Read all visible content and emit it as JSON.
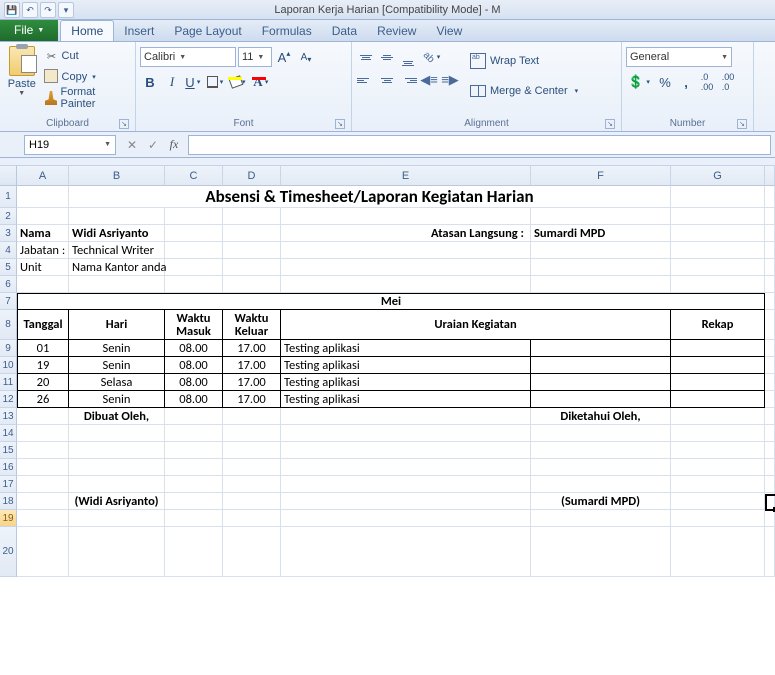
{
  "app": {
    "title": "Laporan Kerja Harian  [Compatibility Mode]  -  M",
    "qat": {
      "save": "💾",
      "undo": "↶",
      "redo": "↷"
    }
  },
  "tabs": {
    "file": "File",
    "home": "Home",
    "insert": "Insert",
    "pageLayout": "Page Layout",
    "formulas": "Formulas",
    "data": "Data",
    "review": "Review",
    "view": "View"
  },
  "ribbon": {
    "clipboard": {
      "paste": "Paste",
      "cut": "Cut",
      "copy": "Copy",
      "formatPainter": "Format Painter",
      "label": "Clipboard"
    },
    "font": {
      "name": "Calibri",
      "size": "11",
      "label": "Font"
    },
    "alignment": {
      "wrapText": "Wrap Text",
      "mergeCenter": "Merge & Center",
      "label": "Alignment"
    },
    "number": {
      "format": "General",
      "label": "Number"
    }
  },
  "namebox": "H19",
  "columns": [
    "A",
    "B",
    "C",
    "D",
    "E",
    "F",
    "G"
  ],
  "rows": [
    1,
    2,
    3,
    4,
    5,
    6,
    7,
    8,
    9,
    10,
    11,
    12,
    13,
    14,
    15,
    16,
    17,
    18,
    19,
    20
  ],
  "sheet": {
    "title": "Absensi & Timesheet/Laporan Kegiatan Harian",
    "labels": {
      "nama": "Nama",
      "jabatan": "Jabatan :",
      "unit": "Unit",
      "atasan": "Atasan Langsung :",
      "dibuat": "Dibuat Oleh,",
      "diketahui": "Diketahui Oleh,"
    },
    "info": {
      "nama": "Widi Asriyanto",
      "jabatan": "Technical Writer",
      "unit": "Nama Kantor anda",
      "atasan": "Sumardi MPD"
    },
    "month": "Mei",
    "headers": {
      "tanggal": "Tanggal",
      "hari": "Hari",
      "masuk": "Waktu Masuk",
      "keluar": "Waktu Keluar",
      "uraian": "Uraian Kegiatan",
      "rekap": "Rekap"
    },
    "rowsData": [
      {
        "tgl": "01",
        "hari": "Senin",
        "in": "08.00",
        "out": "17.00",
        "act": "Testing aplikasi"
      },
      {
        "tgl": "19",
        "hari": "Senin",
        "in": "08.00",
        "out": "17.00",
        "act": "Testing aplikasi"
      },
      {
        "tgl": "20",
        "hari": "Selasa",
        "in": "08.00",
        "out": "17.00",
        "act": "Testing aplikasi"
      },
      {
        "tgl": "26",
        "hari": "Senin",
        "in": "08.00",
        "out": "17.00",
        "act": "Testing aplikasi"
      }
    ],
    "sign1": "(Widi Asriyanto)",
    "sign2": "(Sumardi MPD)"
  }
}
